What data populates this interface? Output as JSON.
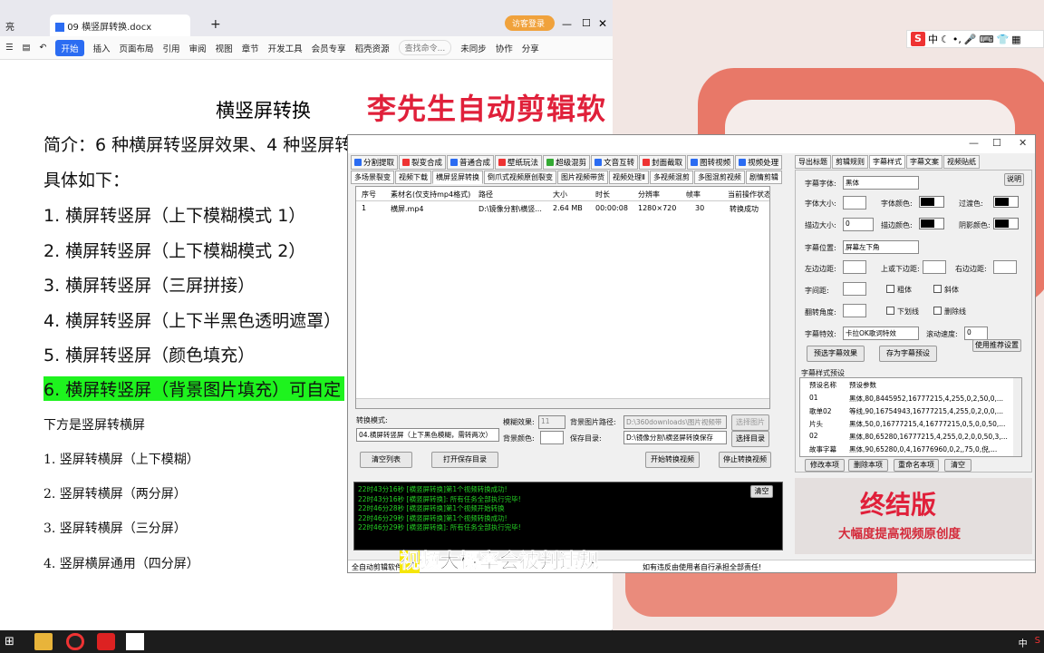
{
  "wps": {
    "tab_left_partial": "亮",
    "doc_tab": "09 横竖屏转换.docx",
    "add_tab": "+",
    "visitor": "访客登录",
    "menus": [
      "开始",
      "插入",
      "页面布局",
      "引用",
      "审阅",
      "视图",
      "章节",
      "开发工具",
      "会员专享",
      "稻壳资源"
    ],
    "search_placeholder": "查找命令...",
    "sync": "未同步",
    "collab": "协作",
    "share": "分享"
  },
  "document": {
    "title": "横竖屏转换",
    "overlay_title": "李先生自动剪辑软件",
    "intro": "简介：6 种横屏转竖屏效果、4 种竖屏转横屏效",
    "detail": "具体如下：",
    "h2v": [
      "1. 横屏转竖屏（上下模糊模式 1）",
      "2. 横屏转竖屏（上下模糊模式 2）",
      "3. 横屏转竖屏（三屏拼接）",
      "4. 横屏转竖屏（上下半黑色透明遮罩）",
      "5. 横屏转竖屏（颜色填充）",
      "6. 横屏转竖屏（背景图片填充）可自定"
    ],
    "section2": "下方是竖屏转横屏",
    "v2h": [
      "1. 竖屏转横屏（上下模糊）",
      "2. 竖屏转横屏（两分屏）",
      "3. 竖屏转横屏（三分屏）",
      "4. 竖屏横屏通用（四分屏）"
    ]
  },
  "app": {
    "tabs_row1": [
      "分割提取",
      "裂变合成",
      "普通合成",
      "壁纸玩法",
      "超级混剪",
      "文音互转",
      "封面截取",
      "图转视频",
      "视频处理"
    ],
    "tabs_row2": [
      "多场景裂变",
      "视频下载",
      "横屏竖屏转换",
      "倒爪式视频原创裂变",
      "图片视频带货",
      "视频处理Ⅱ",
      "多视频混剪",
      "多图混剪视频",
      "剧情剪辑"
    ],
    "table": {
      "headers": [
        "序号",
        "素材名(仅支持mp4格式)",
        "路径",
        "大小",
        "时长",
        "分辨率",
        "帧率",
        "当前操作状态"
      ],
      "rows": [
        [
          "1",
          "横屏.mp4",
          "D:\\镜像分割\\横竖...",
          "2.64 MB",
          "00:00:08",
          "1280×720",
          "30",
          "转换成功"
        ]
      ]
    },
    "mode_label": "转换模式:",
    "mode_value": "04.横屏转竖屏（上下黑色模糊，需转两次）",
    "blur_label": "模糊效果:",
    "blur_value": "11",
    "bg_color_label": "背景颜色:",
    "bg_img_label": "背景图片路径:",
    "bg_img_value": "D:\\360downloads\\图片视频带",
    "save_label": "保存目录:",
    "save_value": "D:\\镜像分割\\横竖屏转换保存",
    "btn_select_img": "选择图片",
    "btn_select_dir": "选择目录",
    "btn_clear": "清空列表",
    "btn_open_dir": "打开保存目录",
    "btn_start": "开始转换视频",
    "btn_stop": "停止转换视频",
    "log": [
      "22时43分16秒 [横竖屏转换]第1个视频转换成功!",
      "22时43分16秒 [横竖屏转换]: 所有任务全部执行完毕!",
      "22时46分28秒 [横竖屏转换]第1个视频开始转换",
      "22时46分29秒 [横竖屏转换]第1个视频转换成功!",
      "22时46分29秒 [横竖屏转换]: 所有任务全部执行完毕!"
    ],
    "clear_log": "清空",
    "status_left": "全自动剪辑软件",
    "status_right": "如有违反由使用者自行承担全部责任!"
  },
  "subtitle": {
    "first": "视",
    "rest": "频大概率会被判违规"
  },
  "right": {
    "tabs": [
      "导出标题",
      "剪辑规则",
      "字幕样式",
      "字幕文案",
      "视频贴纸"
    ],
    "font_label": "字幕字体:",
    "font_value": "黑体",
    "help": "说明",
    "size_label": "字体大小:",
    "color_label": "字体颜色:",
    "transition_label": "过渡色:",
    "stroke_label": "描边大小:",
    "stroke_value": "0",
    "stroke_color_label": "描边颜色:",
    "shadow_label": "阴影颜色:",
    "pos_label": "字幕位置:",
    "pos_value": "屏幕左下角",
    "left_margin": "左边边距:",
    "tb_margin": "上或下边距:",
    "right_margin": "右边边距:",
    "spacing_label": "字间距:",
    "bold": "粗体",
    "italic": "斜体",
    "rotate_label": "翻转角度:",
    "underline": "下划线",
    "strike": "删除线",
    "effect_label": "字幕特效:",
    "effect_value": "卡拉OK歌词特效",
    "speed_label": "滚动速度:",
    "speed_value": "0",
    "btn_preview": "预选字幕效果",
    "btn_save_preset": "存为字幕预设",
    "btn_use_default": "使用推荐设置",
    "preset_title": "字幕样式预设",
    "preset_headers": [
      "预设名称",
      "预设参数"
    ],
    "presets": [
      [
        "01",
        "黑体,80,8445952,16777215,4,255,0,2,50,0,..."
      ],
      [
        "歌单02",
        "等线,90,16754943,16777215,4,255,0,2,0,0,..."
      ],
      [
        "片头",
        "黑体,50,0,16777215,4,16777215,0,5,0,0,50,..."
      ],
      [
        "02",
        "黑体,80,65280,16777215,4,255,0,2,0,0,50,3,..."
      ],
      [
        "故事字幕",
        "黑体,90,65280,0,4,16776960,0,2,,75,0,倪,..."
      ]
    ],
    "btn_edit": "修改本项",
    "btn_delete": "删除本项",
    "btn_rename": "重命名本项",
    "btn_clear": "清空",
    "final_big": "终结版",
    "final_sub": "大幅度提高视频原创度"
  },
  "ime": {
    "cn": "中"
  },
  "tray": {
    "lang": "中"
  },
  "colors": {
    "accent": "#2b6cf2",
    "red": "#e0203a",
    "highlight": "#1ef31e",
    "log": "#24d124"
  }
}
